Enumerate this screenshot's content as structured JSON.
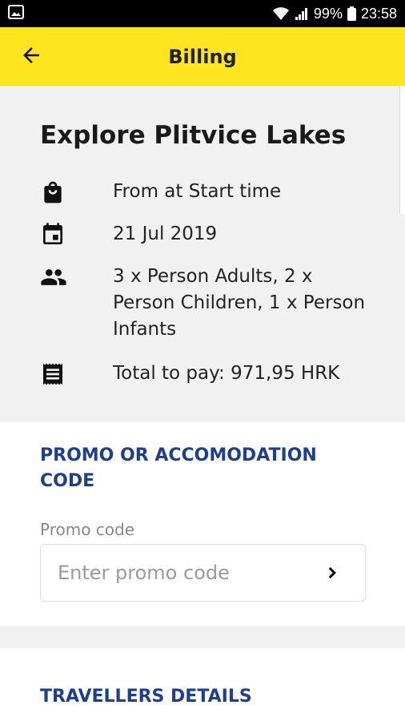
{
  "status_bar": {
    "battery": "99%",
    "time": "23:58",
    "icons": [
      "image-notification-icon",
      "wifi-icon",
      "signal-icon",
      "battery-icon"
    ]
  },
  "app_bar": {
    "title": "Billing",
    "back_icon": "arrow-left-icon",
    "background_color": "#ffe51f"
  },
  "tour": {
    "title": "Explore Plitvice Lakes",
    "details": [
      {
        "icon": "shopping-bag-icon",
        "text": "From at Start time"
      },
      {
        "icon": "calendar-icon",
        "text": "21 Jul 2019"
      },
      {
        "icon": "people-icon",
        "text": "3 x Person Adults, 2 x Person Children, 1 x Person Infants"
      },
      {
        "icon": "receipt-icon",
        "text": "Total to pay: 971,95 HRK"
      }
    ]
  },
  "promo": {
    "heading": "PROMO OR ACCOMODATION CODE",
    "label": "Promo code",
    "placeholder": "Enter promo code",
    "value": "",
    "submit_icon": "chevron-right-icon"
  },
  "travellers": {
    "heading": "TRAVELLERS DETAILS"
  },
  "colors": {
    "accent": "#ffe51f",
    "heading_blue": "#1d3f8f"
  }
}
